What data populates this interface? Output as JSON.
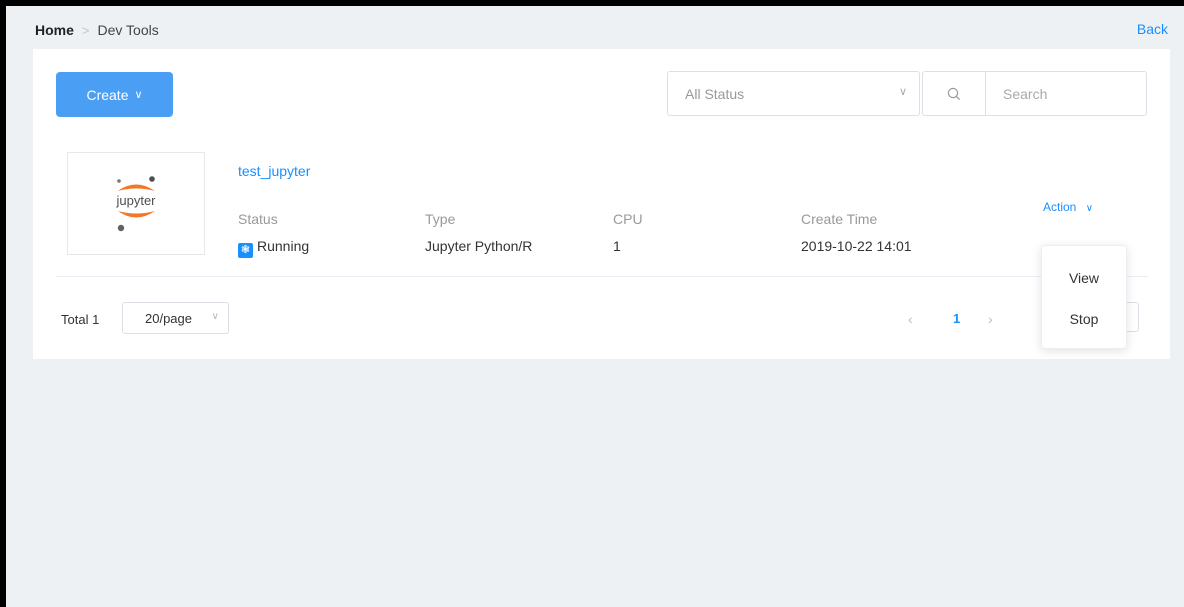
{
  "breadcrumb": {
    "home": "Home",
    "current": "Dev Tools"
  },
  "header": {
    "back_label": "Back"
  },
  "toolbar": {
    "create_label": "Create",
    "status_filter": "All Status",
    "search_placeholder": "Search"
  },
  "instance": {
    "logo_text": "jupyter",
    "name": "test_jupyter",
    "fields": {
      "status_label": "Status",
      "status_value": "Running",
      "type_label": "Type",
      "type_value": "Jupyter Python/R",
      "cpu_label": "CPU",
      "cpu_value": "1",
      "create_time_label": "Create Time",
      "create_time_value": "2019-10-22 14:01"
    },
    "action_label": "Action"
  },
  "pagination": {
    "total": "Total 1",
    "page_size": "20/page",
    "current_page": "1"
  },
  "action_menu": {
    "items": [
      "View",
      "Stop"
    ]
  },
  "colors": {
    "accent": "#1890ff",
    "create_button": "#4a9ff5",
    "background": "#eef1f4",
    "jupyter_orange": "#f37726"
  }
}
